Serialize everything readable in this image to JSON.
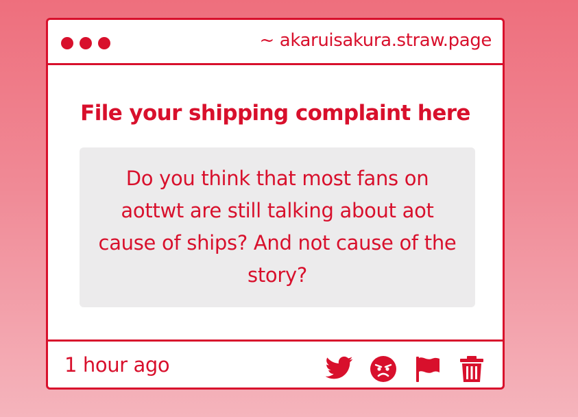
{
  "window": {
    "url": "~ akaruisakura.straw.page"
  },
  "main": {
    "heading": "File your shipping complaint here",
    "question": "Do you think that most fans on aottwt are still talking about aot cause of ships? And not cause of the story?"
  },
  "footer": {
    "timestamp": "1 hour ago",
    "actions": [
      {
        "icon": "twitter-icon"
      },
      {
        "icon": "angry-face-icon"
      },
      {
        "icon": "flag-icon"
      },
      {
        "icon": "trash-icon"
      }
    ]
  },
  "colors": {
    "accent": "#d8102c",
    "box_background": "#ecebec",
    "page_gradient_top": "#ee6f7d",
    "page_gradient_bottom": "#f5b4bc"
  }
}
